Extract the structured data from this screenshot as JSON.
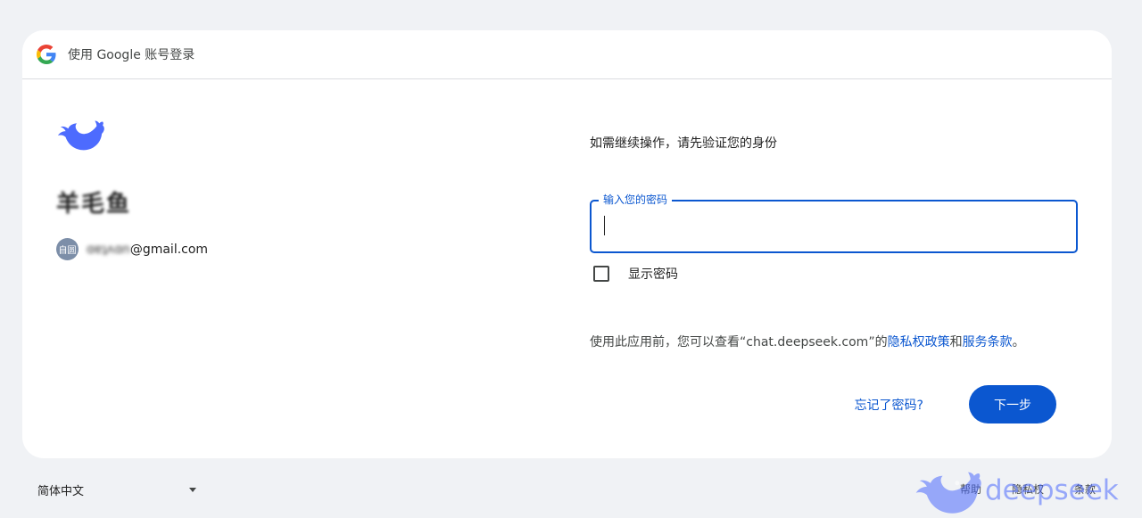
{
  "header": {
    "title": "使用 Google 账号登录",
    "logo_icon": "google-g-icon"
  },
  "account": {
    "app_logo_icon": "deepseek-whale-icon",
    "display_name": "羊毛鱼",
    "avatar_text": "自圆",
    "email_masked": "ɑɐʇʌɑn",
    "email_domain": "@gmail.com"
  },
  "form": {
    "verify_text": "如需继续操作，请先验证您的身份",
    "password_label": "输入您的密码",
    "password_value": "",
    "show_password_label": "显示密码"
  },
  "policy": {
    "prefix": "使用此应用前，您可以查看“chat.deepseek.com”的",
    "privacy_link": "隐私权政策",
    "and": "和",
    "terms_link": "服务条款",
    "suffix": "。"
  },
  "actions": {
    "forgot": "忘记了密码?",
    "next": "下一步"
  },
  "footer": {
    "language": "简体中文",
    "help": "帮助",
    "privacy": "隐私权",
    "terms": "条款"
  },
  "watermark": {
    "text": "deepseek"
  },
  "colors": {
    "primary": "#0b57d0",
    "brand_deepseek": "#4d6bfe"
  }
}
